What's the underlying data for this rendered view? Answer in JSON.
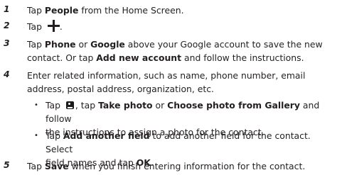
{
  "steps": [
    {
      "num": "1",
      "pre": "Tap ",
      "b1": "People",
      "post": " from the Home Screen."
    },
    {
      "num": "2",
      "pre": "Tap ",
      "icon": "plus-icon",
      "post": "."
    },
    {
      "num": "3",
      "l1_pre": "Tap ",
      "l1_b1": "Phone",
      "l1_mid": " or ",
      "l1_b2": "Google",
      "l1_post": " above your Google account to save the new",
      "l2_pre": "contact. Or tap ",
      "l2_b": "Add new account",
      "l2_post": " and follow the instructions."
    },
    {
      "num": "4",
      "line1": "Enter related information, such as name, phone number, email",
      "line2": "address, postal address, organization, etc.",
      "bullets": [
        {
          "dot": "•",
          "pre": "Tap ",
          "icon": "photo-icon",
          "mid1": ", tap ",
          "b1": "Take photo",
          "mid2": " or ",
          "b2": "Choose photo from Gallery",
          "post1": " and follow",
          "line2": "the instructions to assign a photo for the contact."
        },
        {
          "dot": "•",
          "pre": "Tap ",
          "b1": "Add another field",
          "post1": " to add another field for the contact. Select",
          "line2_pre": "field names and tap ",
          "line2_b": "OK",
          "line2_post": "."
        }
      ]
    },
    {
      "num": "5",
      "pre": "Tap ",
      "b1": "Save",
      "post": " when you finish entering information for the contact."
    }
  ]
}
